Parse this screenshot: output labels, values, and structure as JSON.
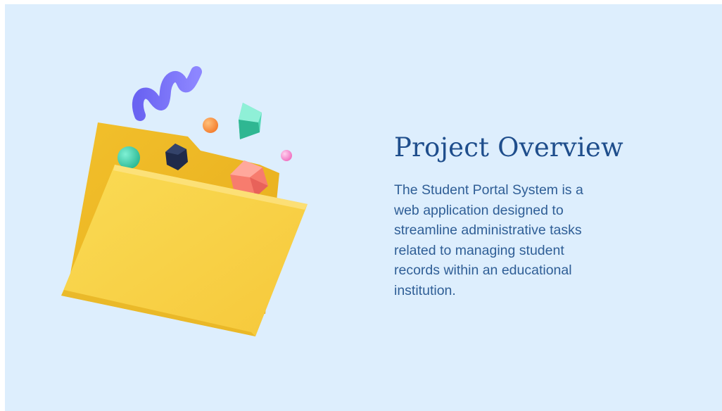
{
  "slide": {
    "title": "Project Overview",
    "description": "The Student Portal System is a web application designed to streamline administrative tasks related to managing student records within an educational institution.",
    "illustration_icon": "folder-icon"
  },
  "colors": {
    "background": "#ddeefd",
    "title": "#1f4e8c",
    "body_text": "#2f5e96",
    "folder": "#f8cd3e"
  }
}
